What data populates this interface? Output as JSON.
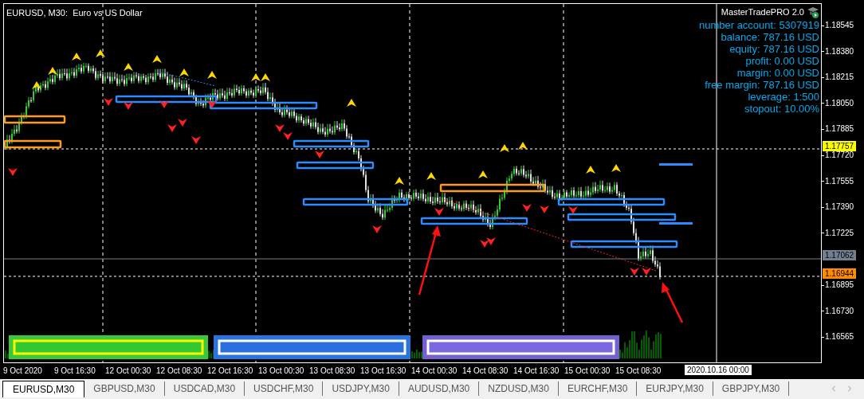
{
  "chart": {
    "title": "EURUSD, M30:  Euro vs US Dollar"
  },
  "panel": {
    "title": "MasterTradePRO 2.0",
    "lines": [
      "number account: 5307919",
      "balance: 787.16 USD",
      "equity: 787.16 USD",
      "profit: 0.00 USD",
      "margin: 0.00 USD",
      "free margin: 787.16 USD",
      "leverage: 1:500",
      "stopout: 10.00%"
    ]
  },
  "price_axis": {
    "ticks": [
      "1.18545",
      "1.18380",
      "1.18215",
      "1.18050",
      "1.17885",
      "1.17720",
      "1.17555",
      "1.17390",
      "1.17225",
      "1.16895",
      "1.16730",
      "1.16565"
    ],
    "markers": [
      {
        "text": "1.17757",
        "color": "#ffff00"
      },
      {
        "text": "1.17062",
        "color": "#708090"
      },
      {
        "text": "1.16944",
        "color": "#ff8c00"
      }
    ]
  },
  "time_axis": {
    "labels": [
      "9 Oct 2020",
      "9 Oct 16:30",
      "12 Oct 00:30",
      "12 Oct 08:30",
      "12 Oct 16:30",
      "13 Oct 00:30",
      "13 Oct 08:30",
      "13 Oct 16:30",
      "14 Oct 00:30",
      "14 Oct 08:30",
      "14 Oct 16:30",
      "15 Oct 00:30",
      "15 Oct 08:30"
    ],
    "cursor_label": "2020.10.16 00:00"
  },
  "tabs": [
    {
      "label": "EURUSD,M30",
      "selected": true
    },
    {
      "label": "GBPUSD,M30",
      "selected": false
    },
    {
      "label": "USDCAD,M30",
      "selected": false
    },
    {
      "label": "USDCHF,M30",
      "selected": false
    },
    {
      "label": "USDJPY,M30",
      "selected": false
    },
    {
      "label": "AUDUSD,M30",
      "selected": false
    },
    {
      "label": "NZDUSD,M30",
      "selected": false
    },
    {
      "label": "EURCHF,M30",
      "selected": false
    },
    {
      "label": "EURJPY,M30",
      "selected": false
    },
    {
      "label": "GBPJPY,M30",
      "selected": false
    }
  ]
}
